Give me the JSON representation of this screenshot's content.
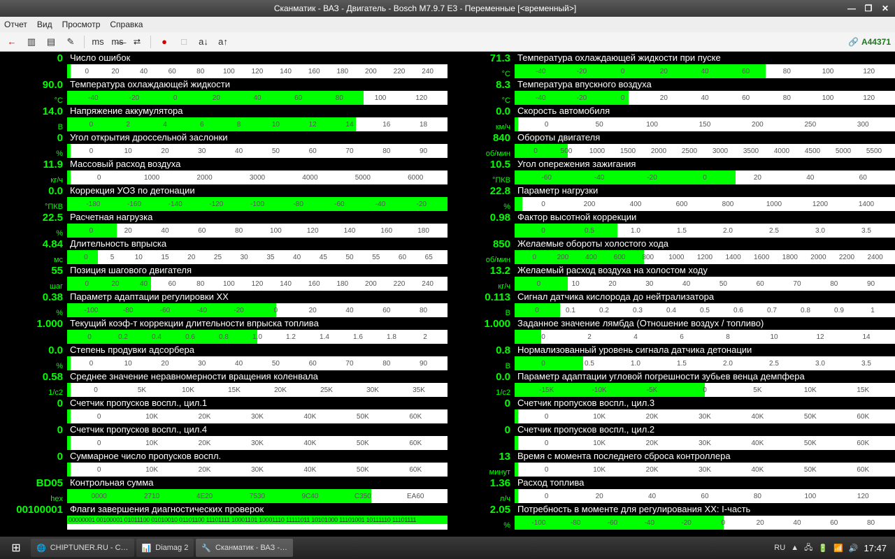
{
  "window": {
    "title": "Сканматик - ВАЗ - Двигатель - Bosch M7.9.7 E3 - Переменные [<временный>]",
    "min": "—",
    "max": "❐",
    "close": "✕"
  },
  "menu": {
    "report": "Отчет",
    "view": "Вид",
    "browse": "Просмотр",
    "help": "Справка"
  },
  "toolbar": {
    "connection": "A44371",
    "icons": [
      "arrow-left",
      "page",
      "list",
      "pencil",
      "ms-badge",
      "ms-strike",
      "link",
      "record",
      "disabled-1",
      "a-down",
      "a-up"
    ],
    "glyphs": [
      "←",
      "▥",
      "▤",
      "✎",
      "ms",
      "m̶s̶",
      "⮂",
      "●",
      "□",
      "a↓",
      "a↑"
    ]
  },
  "params_left": [
    {
      "value": "0",
      "unit": "",
      "name": "Число ошибок",
      "ticks": [
        "0",
        "20",
        "40",
        "60",
        "80",
        "100",
        "120",
        "140",
        "160",
        "180",
        "200",
        "220",
        "240"
      ],
      "fl": 0,
      "fr": 1
    },
    {
      "value": "90.0",
      "unit": "°C",
      "name": "Температура охлаждающей жидкости",
      "ticks": [
        "-40",
        "-20",
        "0",
        "20",
        "40",
        "60",
        "80",
        "100",
        "120"
      ],
      "fl": 0,
      "fr": 78
    },
    {
      "value": "14.0",
      "unit": "В",
      "name": "Напряжение аккумулятора",
      "ticks": [
        "0",
        "2",
        "4",
        "6",
        "8",
        "10",
        "12",
        "14",
        "16",
        "18"
      ],
      "fl": 0,
      "fr": 76
    },
    {
      "value": "0",
      "unit": "%",
      "name": "Угол открытия дроссельной заслонки",
      "ticks": [
        "0",
        "10",
        "20",
        "30",
        "40",
        "50",
        "60",
        "70",
        "80",
        "90"
      ],
      "fl": 0,
      "fr": 1
    },
    {
      "value": "11.9",
      "unit": "кг/ч",
      "name": "Массовый расход воздуха",
      "ticks": [
        "0",
        "1000",
        "2000",
        "3000",
        "4000",
        "5000",
        "6000"
      ],
      "fl": 0,
      "fr": 1
    },
    {
      "value": "0.0",
      "unit": "°ПКВ",
      "name": "Коррекция УОЗ по детонации",
      "ticks": [
        "-180",
        "-160",
        "-140",
        "-120",
        "-100",
        "-80",
        "-60",
        "-40",
        "-20"
      ],
      "fl": 0,
      "fr": 100
    },
    {
      "value": "22.5",
      "unit": "%",
      "name": "Расчетная нагрузка",
      "ticks": [
        "0",
        "20",
        "40",
        "60",
        "80",
        "100",
        "120",
        "140",
        "160",
        "180"
      ],
      "fl": 0,
      "fr": 13
    },
    {
      "value": "4.84",
      "unit": "мс",
      "name": "Длительность впрыска",
      "ticks": [
        "0",
        "5",
        "10",
        "15",
        "20",
        "25",
        "30",
        "35",
        "40",
        "45",
        "50",
        "55",
        "60",
        "65"
      ],
      "fl": 0,
      "fr": 8
    },
    {
      "value": "55",
      "unit": "шаг",
      "name": "Позиция шагового двигателя",
      "ticks": [
        "0",
        "20",
        "40",
        "60",
        "80",
        "100",
        "120",
        "140",
        "160",
        "180",
        "200",
        "220",
        "240"
      ],
      "fl": 0,
      "fr": 22
    },
    {
      "value": "0.38",
      "unit": "%",
      "name": "Параметр адаптации регулировки ХХ",
      "ticks": [
        "-100",
        "-80",
        "-60",
        "-40",
        "-20",
        "0",
        "20",
        "40",
        "60",
        "80"
      ],
      "fl": 0,
      "fr": 55
    },
    {
      "value": "1.000",
      "unit": "",
      "name": "Текущий коэф-т коррекции длительности впрыска топлива",
      "ticks": [
        "0",
        "0.2",
        "0.4",
        "0.6",
        "0.8",
        "1.0",
        "1.2",
        "1.4",
        "1.6",
        "1.8",
        "2"
      ],
      "fl": 0,
      "fr": 50
    },
    {
      "value": "0.0",
      "unit": "%",
      "name": "Степень продувки адсорбера",
      "ticks": [
        "0",
        "10",
        "20",
        "30",
        "40",
        "50",
        "60",
        "70",
        "80",
        "90"
      ],
      "fl": 0,
      "fr": 1
    },
    {
      "value": "0.58",
      "unit": "1/c2",
      "name": "Среднее значение неравномерности вращения коленвала",
      "ticks": [
        "0",
        "5K",
        "10K",
        "15K",
        "20K",
        "25K",
        "30K",
        "35K"
      ],
      "fl": 0,
      "fr": 1
    },
    {
      "value": "0",
      "unit": "",
      "name": "Счетчик пропусков воспл., цил.1",
      "ticks": [
        "0",
        "10K",
        "20K",
        "30K",
        "40K",
        "50K",
        "60K"
      ],
      "fl": 0,
      "fr": 1
    },
    {
      "value": "0",
      "unit": "",
      "name": "Счетчик пропусков воспл., цил.4",
      "ticks": [
        "0",
        "10K",
        "20K",
        "30K",
        "40K",
        "50K",
        "60K"
      ],
      "fl": 0,
      "fr": 1
    },
    {
      "value": "0",
      "unit": "",
      "name": "Суммарное число пропусков воспл.",
      "ticks": [
        "0",
        "10K",
        "20K",
        "30K",
        "40K",
        "50K",
        "60K"
      ],
      "fl": 0,
      "fr": 1
    },
    {
      "value": "BD05",
      "unit": "hex",
      "name": "Контрольная сумма",
      "ticks": [
        "0000",
        "2710",
        "4E20",
        "7530",
        "9C40",
        "C350",
        "EA60"
      ],
      "fl": 0,
      "fr": 80
    },
    {
      "value": "00100001",
      "unit": "",
      "name": "Флаги завершения диагностических проверок",
      "binary": "00000001 00100001 01011100 01010010 01101100 11101111 10001101 10001110 11111011 10101000 11101001 10111110 11101111"
    }
  ],
  "params_right": [
    {
      "value": "71.3",
      "unit": "°C",
      "name": "Температура охлаждающей жидкости при пуске",
      "ticks": [
        "-40",
        "-20",
        "0",
        "20",
        "40",
        "60",
        "80",
        "100",
        "120"
      ],
      "fl": 0,
      "fr": 66
    },
    {
      "value": "8.3",
      "unit": "°C",
      "name": "Температура впускного воздуха",
      "ticks": [
        "-40",
        "-20",
        "0",
        "20",
        "40",
        "60",
        "80",
        "100",
        "120"
      ],
      "fl": 0,
      "fr": 30
    },
    {
      "value": "0.0",
      "unit": "км/ч",
      "name": "Скорость автомобиля",
      "ticks": [
        "0",
        "50",
        "100",
        "150",
        "200",
        "250",
        "300"
      ],
      "fl": 0,
      "fr": 1
    },
    {
      "value": "840",
      "unit": "об/мин",
      "name": "Обороты  двигателя",
      "ticks": [
        "0",
        "500",
        "1000",
        "1500",
        "2000",
        "2500",
        "3000",
        "3500",
        "4000",
        "4500",
        "5000",
        "5500"
      ],
      "fl": 0,
      "fr": 14
    },
    {
      "value": "10.5",
      "unit": "°ПКВ",
      "name": "Угол опережения зажигания",
      "ticks": [
        "-60",
        "-40",
        "-20",
        "0",
        "20",
        "40",
        "60"
      ],
      "fl": 0,
      "fr": 58
    },
    {
      "value": "22.8",
      "unit": "%",
      "name": "Параметр нагрузки",
      "ticks": [
        "0",
        "200",
        "400",
        "600",
        "800",
        "1000",
        "1200",
        "1400"
      ],
      "fl": 0,
      "fr": 2
    },
    {
      "value": "0.98",
      "unit": "",
      "name": "Фактор высотной коррекции",
      "ticks": [
        "0",
        "0.5",
        "1.0",
        "1.5",
        "2.0",
        "2.5",
        "3.0",
        "3.5"
      ],
      "fl": 0,
      "fr": 27
    },
    {
      "value": "850",
      "unit": "об/мин",
      "name": "Желаемые обороты холостого хода",
      "ticks": [
        "0",
        "200",
        "400",
        "600",
        "800",
        "1000",
        "1200",
        "1400",
        "1600",
        "1800",
        "2000",
        "2200",
        "2400"
      ],
      "fl": 0,
      "fr": 34
    },
    {
      "value": "13.2",
      "unit": "кг/ч",
      "name": "Желаемый расход воздуха на холостом ходу",
      "ticks": [
        "0",
        "10",
        "20",
        "30",
        "40",
        "50",
        "60",
        "70",
        "80",
        "90"
      ],
      "fl": 0,
      "fr": 14
    },
    {
      "value": "0.113",
      "unit": "В",
      "name": "Сигнал датчика кислорода до нейтрализатора",
      "ticks": [
        "0",
        "0.1",
        "0.2",
        "0.3",
        "0.4",
        "0.5",
        "0.6",
        "0.7",
        "0.8",
        "0.9",
        "1"
      ],
      "fl": 0,
      "fr": 12
    },
    {
      "value": "1.000",
      "unit": "",
      "name": "Заданное значение лямбда (Отношение воздух / топливо)",
      "ticks": [
        "0",
        "2",
        "4",
        "6",
        "8",
        "10",
        "12",
        "14"
      ],
      "fl": 0,
      "fr": 7
    },
    {
      "value": "0.8",
      "unit": "В",
      "name": "Нормализованный уровень сигнала датчика детонации",
      "ticks": [
        "0",
        "0.5",
        "1.0",
        "1.5",
        "2.0",
        "2.5",
        "3.0",
        "3.5"
      ],
      "fl": 0,
      "fr": 18
    },
    {
      "value": "0.0",
      "unit": "1/c2",
      "name": "Параметр адаптации угловой погрешности зубьев венца демпфера",
      "ticks": [
        "-15K",
        "-10K",
        "-5K",
        "0",
        "5K",
        "10K",
        "15K"
      ],
      "fl": 0,
      "fr": 50
    },
    {
      "value": "0",
      "unit": "",
      "name": "Счетчик пропусков воспл., цил.3",
      "ticks": [
        "0",
        "10K",
        "20K",
        "30K",
        "40K",
        "50K",
        "60K"
      ],
      "fl": 0,
      "fr": 1
    },
    {
      "value": "0",
      "unit": "",
      "name": "Счетчик пропусков воспл., цил.2",
      "ticks": [
        "0",
        "10K",
        "20K",
        "30K",
        "40K",
        "50K",
        "60K"
      ],
      "fl": 0,
      "fr": 1
    },
    {
      "value": "13",
      "unit": "минут",
      "name": "Время с момента последнего сброса контроллера",
      "ticks": [
        "0",
        "10K",
        "20K",
        "30K",
        "40K",
        "50K",
        "60K"
      ],
      "fl": 0,
      "fr": 1
    },
    {
      "value": "1.36",
      "unit": "л/ч",
      "name": "Расход топлива",
      "ticks": [
        "0",
        "20",
        "40",
        "60",
        "80",
        "100",
        "120"
      ],
      "fl": 0,
      "fr": 1
    },
    {
      "value": "2.05",
      "unit": "%",
      "name": "Потребность в моменте для регулирования ХХ: I-часть",
      "ticks": [
        "-100",
        "-80",
        "-60",
        "-40",
        "-20",
        "0",
        "20",
        "40",
        "60",
        "80"
      ],
      "fl": 0,
      "fr": 55
    }
  ],
  "taskbar": {
    "tasks": [
      {
        "icon": "🌐",
        "label": "CHIPTUNER.RU - C…"
      },
      {
        "icon": "📊",
        "label": "Diamag 2"
      },
      {
        "icon": "🔧",
        "label": "Сканматик - ВАЗ -…"
      }
    ],
    "lang": "RU",
    "clock": "17:47"
  }
}
